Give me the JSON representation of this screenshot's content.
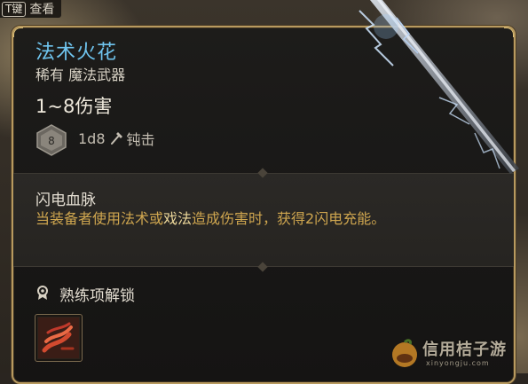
{
  "hint": {
    "key": "T键",
    "label": "查看"
  },
  "item": {
    "name": "法术火花",
    "rarity_type": "稀有 魔法武器",
    "damage": "1~8伤害",
    "die": "8",
    "die_formula": "1d8",
    "damage_type": "钝击"
  },
  "passive": {
    "title": "闪电血脉",
    "desc_part1": "当装备者使用法术或",
    "desc_keyword": "戏法",
    "desc_part2": "造成伤害时，获得2闪电充能。"
  },
  "proficiency": {
    "label": "熟练项解锁"
  },
  "watermark": {
    "text": "信用桔子游",
    "sub": "xinyongju.com"
  },
  "colors": {
    "title": "#6fc4ee",
    "passive_text": "#cfa64f",
    "frame_gold": "#b89a5f"
  },
  "icons": [
    "dice-icon",
    "hammer-icon",
    "proficiency-icon",
    "skill-icon",
    "staff-art"
  ]
}
